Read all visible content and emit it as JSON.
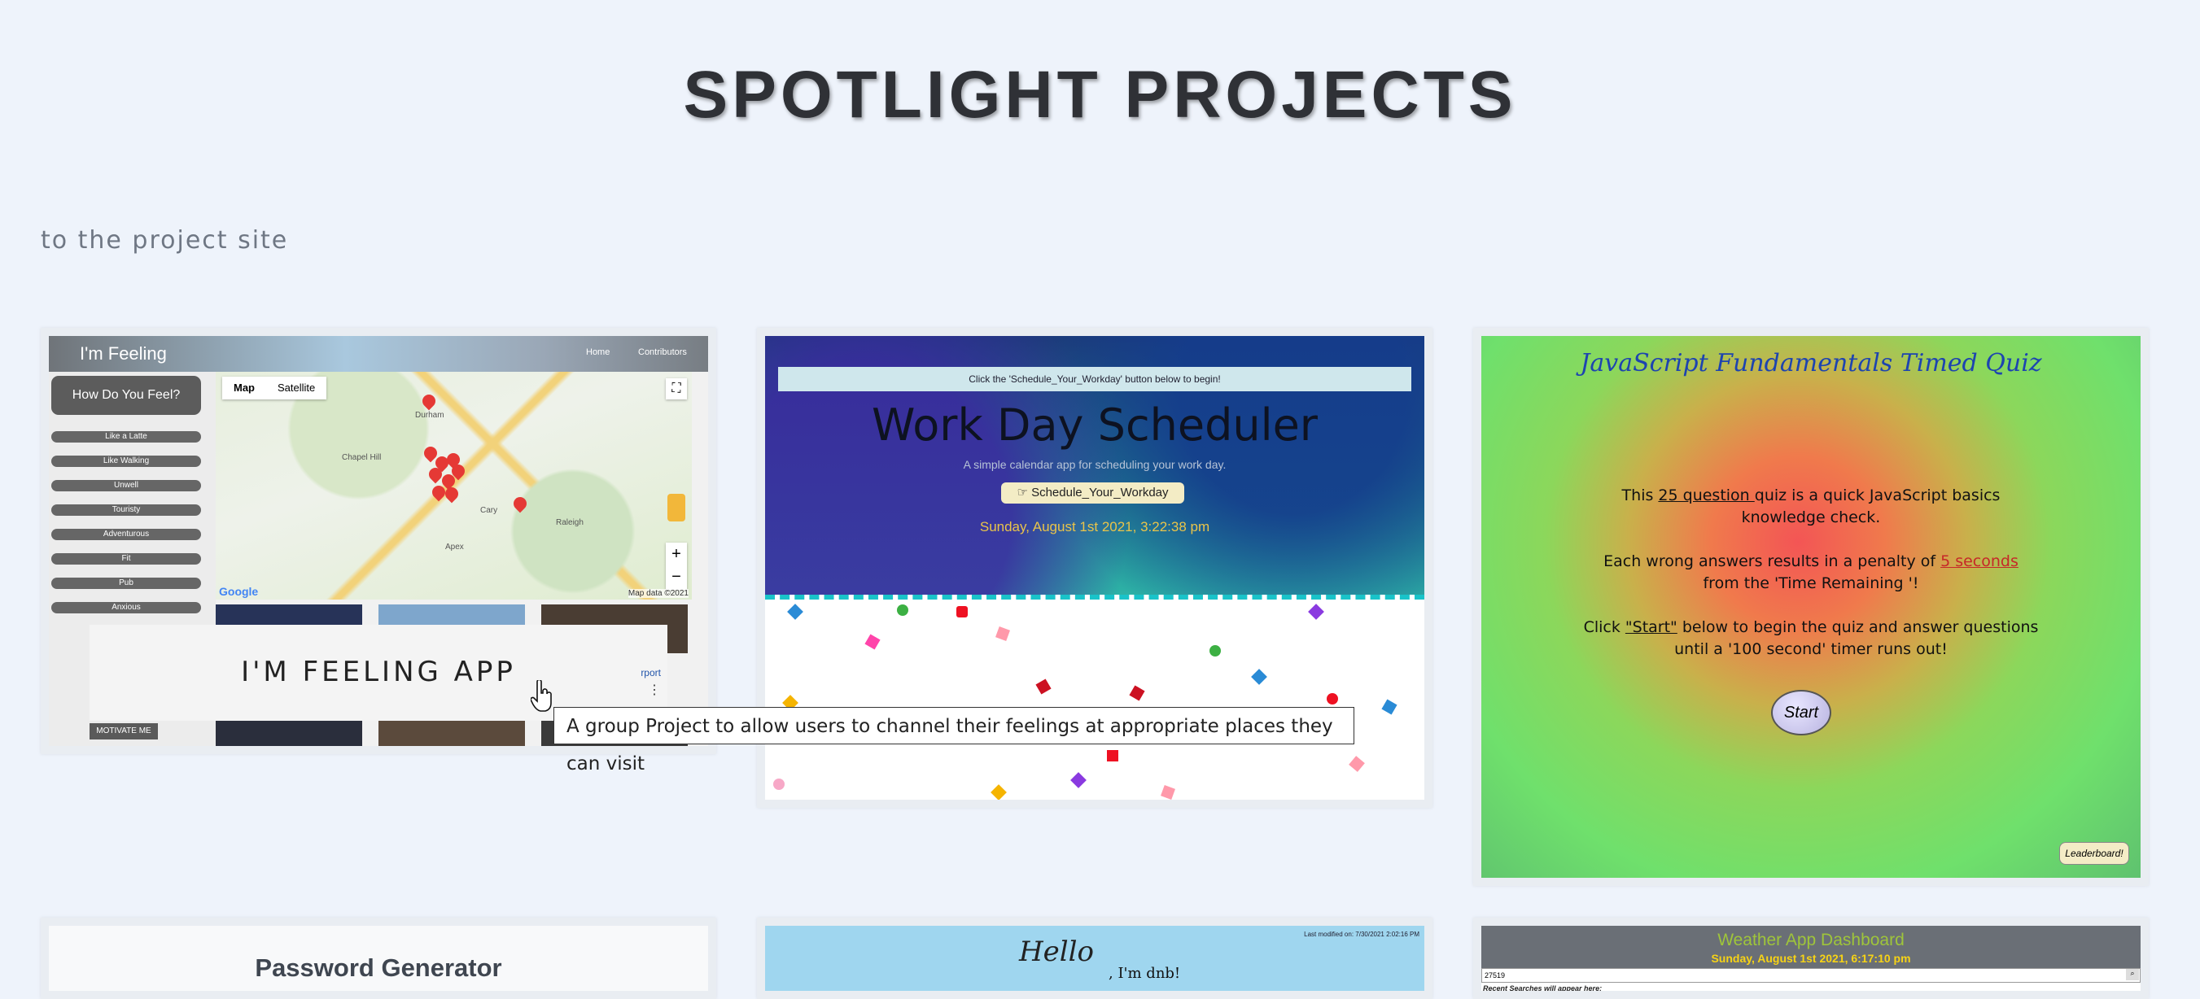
{
  "page": {
    "heading": "SPOTLIGHT PROJECTS",
    "subline": "to the project site"
  },
  "tooltip": "A group Project to allow users to channel their feelings at appropriate places they can visit",
  "colors": {
    "background": "#eef3fb",
    "heading": "#2f3136"
  },
  "cards": {
    "feeling": {
      "overlay_title": "I'M FEELING APP",
      "app_title": "I'm Feeling",
      "nav": [
        "Home",
        "Contributors"
      ],
      "how_button": "How Do You Feel?",
      "options": [
        "Like a Latte",
        "Like Walking",
        "Unwell",
        "Touristy",
        "Adventurous",
        "Fit",
        "Pub",
        "Anxious"
      ],
      "motivate": "MOTIVATE ME",
      "map_buttons": [
        "Map",
        "Satellite"
      ],
      "places": [
        "Durham",
        "Chapel Hill",
        "Raleigh",
        "Cary",
        "Apex"
      ],
      "map_logo": "Google",
      "map_data": "Map data ©2021",
      "link_fragment": "rport"
    },
    "scheduler": {
      "note": "Click the 'Schedule_Your_Workday' button below to begin!",
      "title": "Work Day Scheduler",
      "subtitle": "A simple calendar app for scheduling your work day.",
      "button": "☞ Schedule_Your_Workday",
      "date": "Sunday, August 1st 2021, 3:22:38 pm"
    },
    "quiz": {
      "title": "JavaScript Fundamentals Timed Quiz",
      "p1a": "This ",
      "p1u": "25 question ",
      "p1b": "quiz is a quick JavaScript basics",
      "p1c": "knowledge check.",
      "p2a": "Each wrong answers results in a penalty of ",
      "p2r": "5 seconds",
      "p2b": "from the 'Time Remaining '!",
      "p3a": "Click ",
      "p3u": "\"Start\"",
      "p3b": " below to begin the quiz and answer questions",
      "p3c": "until a '100 second' timer runs out!",
      "start": "Start",
      "leaderboard": "Leaderboard!"
    },
    "password": {
      "title": "Password Generator"
    },
    "hello": {
      "logo": "Hello",
      "sub": ", I'm dnb!",
      "corner": "Last modified on: 7/30/2021 2:02:16 PM"
    },
    "weather": {
      "title": "Weather App Dashboard",
      "date": "Sunday, August 1st 2021, 6:17:10 pm",
      "input": "27519",
      "recent": "Recent Searches will appear here:"
    }
  }
}
